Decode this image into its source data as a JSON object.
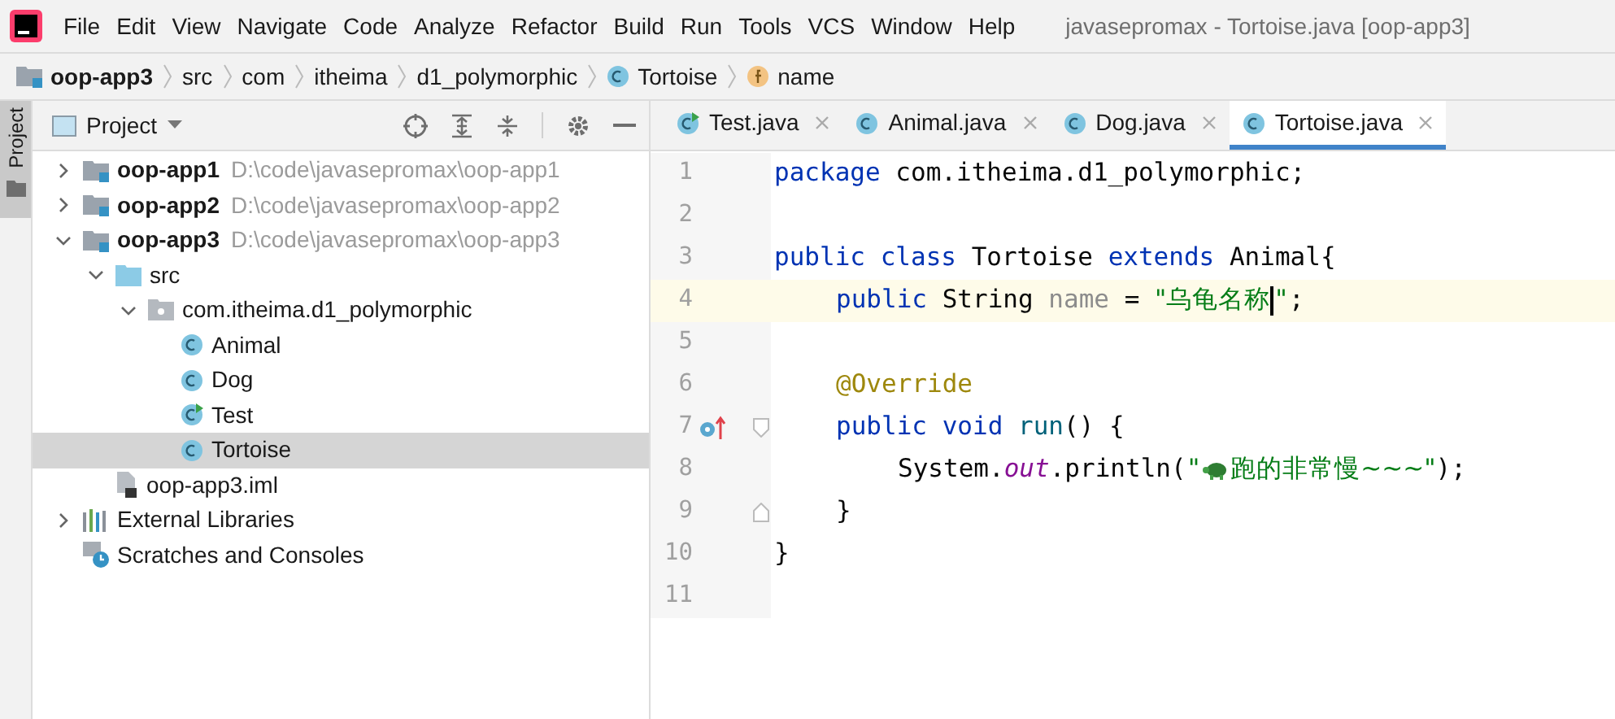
{
  "window": {
    "title": "javasepromax - Tortoise.java [oop-app3]"
  },
  "menu": [
    "File",
    "Edit",
    "View",
    "Navigate",
    "Code",
    "Analyze",
    "Refactor",
    "Build",
    "Run",
    "Tools",
    "VCS",
    "Window",
    "Help"
  ],
  "breadcrumbs": [
    {
      "label": "oop-app3",
      "kind": "module"
    },
    {
      "label": "src",
      "kind": "plain"
    },
    {
      "label": "com",
      "kind": "plain"
    },
    {
      "label": "itheima",
      "kind": "plain"
    },
    {
      "label": "d1_polymorphic",
      "kind": "plain"
    },
    {
      "label": "Tortoise",
      "kind": "class"
    },
    {
      "label": "name",
      "kind": "field"
    }
  ],
  "side_strip": {
    "label": "Project"
  },
  "project_panel": {
    "title": "Project",
    "tree": [
      {
        "label": "oop-app1",
        "path": "D:\\code\\javasepromax\\oop-app1",
        "kind": "module",
        "expanded": false,
        "selected": false
      },
      {
        "label": "oop-app2",
        "path": "D:\\code\\javasepromax\\oop-app2",
        "kind": "module",
        "expanded": false,
        "selected": false
      },
      {
        "label": "oop-app3",
        "path": "D:\\code\\javasepromax\\oop-app3",
        "kind": "module",
        "expanded": true,
        "selected": false,
        "children": [
          {
            "label": "src",
            "kind": "folder",
            "expanded": true,
            "selected": false,
            "children": [
              {
                "label": "com.itheima.d1_polymorphic",
                "kind": "package",
                "expanded": true,
                "selected": false,
                "children": [
                  {
                    "label": "Animal",
                    "kind": "class",
                    "selected": false
                  },
                  {
                    "label": "Dog",
                    "kind": "class",
                    "selected": false
                  },
                  {
                    "label": "Test",
                    "kind": "class-run",
                    "selected": false
                  },
                  {
                    "label": "Tortoise",
                    "kind": "class",
                    "selected": true
                  }
                ]
              }
            ]
          },
          {
            "label": "oop-app3.iml",
            "kind": "file",
            "selected": false
          }
        ]
      },
      {
        "label": "External Libraries",
        "kind": "libraries",
        "expanded": false,
        "selected": false
      },
      {
        "label": "Scratches and Consoles",
        "kind": "scratches",
        "selected": false
      }
    ]
  },
  "editor_tabs": [
    {
      "label": "Test.java",
      "kind": "class-run",
      "selected": false
    },
    {
      "label": "Animal.java",
      "kind": "class",
      "selected": false
    },
    {
      "label": "Dog.java",
      "kind": "class",
      "selected": false
    },
    {
      "label": "Tortoise.java",
      "kind": "class",
      "selected": true
    }
  ],
  "code_lines": [
    {
      "number": "1",
      "current": false,
      "tokens": [
        {
          "kind": "keyword",
          "text": "package"
        },
        {
          "kind": "plain",
          "text": " com.itheima.d1_polymorphic;"
        }
      ]
    },
    {
      "number": "2",
      "current": false
    },
    {
      "number": "3",
      "current": false,
      "tokens": [
        {
          "kind": "keyword",
          "text": "public class"
        },
        {
          "kind": "plain",
          "text": " Tortoise "
        },
        {
          "kind": "keyword",
          "text": "extends"
        },
        {
          "kind": "plain",
          "text": " Animal{"
        }
      ]
    },
    {
      "number": "4",
      "current": true,
      "tokens": [
        {
          "kind": "indent"
        },
        {
          "kind": "keyword",
          "text": "public"
        },
        {
          "kind": "plain",
          "text": " String "
        },
        {
          "kind": "field",
          "text": "name"
        },
        {
          "kind": "plain",
          "text": " = "
        },
        {
          "kind": "string",
          "text": "\"乌龟名称"
        },
        {
          "kind": "caret"
        },
        {
          "kind": "string",
          "text": "\""
        },
        {
          "kind": "plain",
          "text": ";"
        }
      ]
    },
    {
      "number": "5",
      "current": false
    },
    {
      "number": "6",
      "current": false,
      "tokens": [
        {
          "kind": "indent"
        },
        {
          "kind": "annotation",
          "text": "@Override"
        }
      ]
    },
    {
      "number": "7",
      "current": false,
      "override_marker": true,
      "fold_start": true,
      "tokens": [
        {
          "kind": "indent"
        },
        {
          "kind": "keyword",
          "text": "public void"
        },
        {
          "kind": "method",
          "text": " run"
        },
        {
          "kind": "plain",
          "text": "() {"
        }
      ]
    },
    {
      "number": "8",
      "current": false,
      "tokens": [
        {
          "kind": "indent"
        },
        {
          "kind": "indent"
        },
        {
          "kind": "plain",
          "text": "System."
        },
        {
          "kind": "static",
          "text": "out"
        },
        {
          "kind": "plain",
          "text": ".println("
        },
        {
          "kind": "string",
          "text": "\""
        },
        {
          "kind": "turtle"
        },
        {
          "kind": "string",
          "text": "跑的非常慢~~~\""
        },
        {
          "kind": "plain",
          "text": ");"
        }
      ]
    },
    {
      "number": "9",
      "current": false,
      "fold_end": true,
      "tokens": [
        {
          "kind": "indent"
        },
        {
          "kind": "plain",
          "text": "}"
        }
      ]
    },
    {
      "number": "10",
      "current": false,
      "tokens": [
        {
          "kind": "plain",
          "text": "}"
        }
      ]
    },
    {
      "number": "11",
      "current": false
    }
  ]
}
